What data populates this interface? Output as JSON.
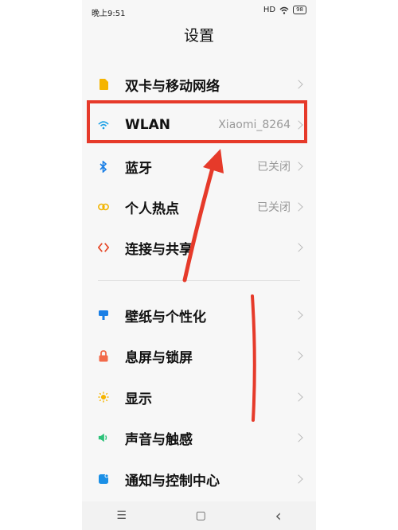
{
  "status_bar": {
    "time": "晚上9:51",
    "signal": "HD",
    "battery": "98"
  },
  "page_title": "设置",
  "menu": {
    "items": [
      {
        "label": "双卡与移动网络",
        "value": "",
        "icon": "sim-card-icon",
        "color": "#f5b400"
      },
      {
        "label": "WLAN",
        "value": "Xiaomi_8264",
        "icon": "wifi-icon",
        "color": "#1aa0e6"
      },
      {
        "label": "蓝牙",
        "value": "已关闭",
        "icon": "bluetooth-icon",
        "color": "#1a7fe6"
      },
      {
        "label": "个人热点",
        "value": "已关闭",
        "icon": "hotspot-icon",
        "color": "#f1b400"
      },
      {
        "label": "连接与共享",
        "value": "",
        "icon": "share-icon",
        "color": "#e64a2a"
      },
      {
        "label": "壁纸与个性化",
        "value": "",
        "icon": "wallpaper-icon",
        "color": "#1a7fe6"
      },
      {
        "label": "息屏与锁屏",
        "value": "",
        "icon": "lock-icon",
        "color": "#f26a4a"
      },
      {
        "label": "显示",
        "value": "",
        "icon": "brightness-icon",
        "color": "#f5b400"
      },
      {
        "label": "声音与触感",
        "value": "",
        "icon": "sound-icon",
        "color": "#2ec27a"
      },
      {
        "label": "通知与控制中心",
        "value": "",
        "icon": "notification-icon",
        "color": "#1a8fe6"
      }
    ]
  },
  "nav_bar": {
    "menu_glyph": "☰",
    "home_glyph": "▢",
    "back_glyph": "‹"
  },
  "colors": {
    "annotation_red": "#e63a2a"
  }
}
